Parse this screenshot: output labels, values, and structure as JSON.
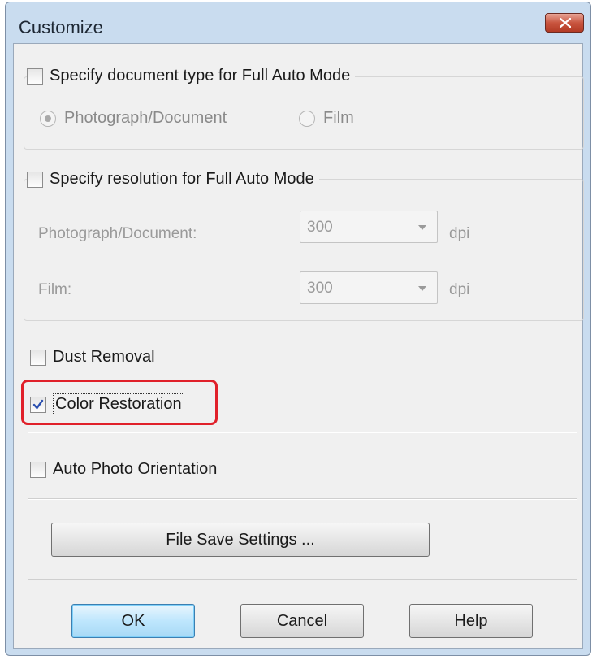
{
  "window": {
    "title": "Customize",
    "close_icon": "close-icon"
  },
  "doc_type_group": {
    "checkbox_label": "Specify document type for Full Auto Mode",
    "checked": false,
    "options": [
      "Photograph/Document",
      "Film"
    ],
    "selected": "Photograph/Document"
  },
  "resolution_group": {
    "checkbox_label": "Specify resolution for Full Auto Mode",
    "checked": false,
    "photo_label": "Photograph/Document:",
    "photo_value": "300",
    "film_label": "Film:",
    "film_value": "300",
    "unit": "dpi"
  },
  "options": {
    "dust_removal": {
      "label": "Dust Removal",
      "checked": false
    },
    "color_restoration": {
      "label": "Color Restoration",
      "checked": true
    },
    "auto_photo_orientation": {
      "label": "Auto Photo Orientation",
      "checked": false
    }
  },
  "buttons": {
    "file_save_settings": "File Save Settings ...",
    "ok": "OK",
    "cancel": "Cancel",
    "help": "Help"
  },
  "colors": {
    "highlight": "#e0202a",
    "titlebar": "#c9dcef",
    "close": "#c9553f"
  }
}
